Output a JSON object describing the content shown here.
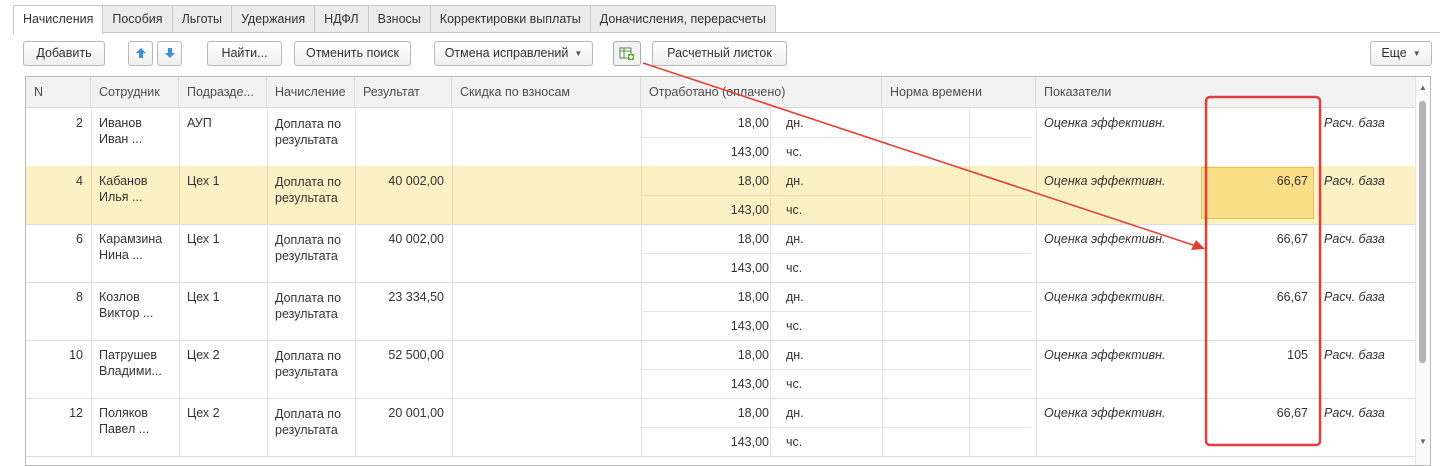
{
  "tabs": [
    "Начисления",
    "Пособия",
    "Льготы",
    "Удержания",
    "НДФЛ",
    "Взносы",
    "Корректировки выплаты",
    "Доначисления, перерасчеты"
  ],
  "toolbar": {
    "add": "Добавить",
    "find": "Найти...",
    "cancel_search": "Отменить поиск",
    "cancel_fix": "Отмена исправлений",
    "payslip": "Расчетный листок",
    "more": "Еще",
    "up_icon": "arrow-up-icon",
    "down_icon": "arrow-down-icon",
    "table_icon": "table-add-icon"
  },
  "columns": {
    "n": "N",
    "employee": "Сотрудник",
    "dept": "Подразде...",
    "accrual": "Начисление",
    "result": "Результат",
    "discount": "Скидка по взносам",
    "worked": "Отработано (оплачено)",
    "norm": "Норма времени",
    "indicators": "Показатели"
  },
  "rows": [
    {
      "n": "2",
      "name1": "Иванов",
      "name2": "Иван ...",
      "dept": "АУП",
      "accrual": "Доплата по результата",
      "result": "",
      "days": "18,00",
      "days_u": "дн.",
      "hours": "143,00",
      "hours_u": "чс.",
      "indicator": "Оценка эффективн.",
      "value": "",
      "base": "Расч. база"
    },
    {
      "n": "4",
      "name1": "Кабанов",
      "name2": "Илья ...",
      "dept": "Цех 1",
      "accrual": "Доплата по результата",
      "result": "40 002,00",
      "days": "18,00",
      "days_u": "дн.",
      "hours": "143,00",
      "hours_u": "чс.",
      "indicator": "Оценка эффективн.",
      "value": "66,67",
      "base": "Расч. база"
    },
    {
      "n": "6",
      "name1": "Карамзина",
      "name2": "Нина ...",
      "dept": "Цех 1",
      "accrual": "Доплата по результата",
      "result": "40 002,00",
      "days": "18,00",
      "days_u": "дн.",
      "hours": "143,00",
      "hours_u": "чс.",
      "indicator": "Оценка эффективн.",
      "value": "66,67",
      "base": "Расч. база"
    },
    {
      "n": "8",
      "name1": "Козлов",
      "name2": "Виктор ...",
      "dept": "Цех 1",
      "accrual": "Доплата по результата",
      "result": "23 334,50",
      "days": "18,00",
      "days_u": "дн.",
      "hours": "143,00",
      "hours_u": "чс.",
      "indicator": "Оценка эффективн.",
      "value": "66,67",
      "base": "Расч. база"
    },
    {
      "n": "10",
      "name1": "Патрушев",
      "name2": "Владими...",
      "dept": "Цех 2",
      "accrual": "Доплата по результата",
      "result": "52 500,00",
      "days": "18,00",
      "days_u": "дн.",
      "hours": "143,00",
      "hours_u": "чс.",
      "indicator": "Оценка эффективн.",
      "value": "105",
      "base": "Расч. база"
    },
    {
      "n": "12",
      "name1": "Поляков",
      "name2": "Павел ...",
      "dept": "Цех 2",
      "accrual": "Доплата по результата",
      "result": "20 001,00",
      "days": "18,00",
      "days_u": "дн.",
      "hours": "143,00",
      "hours_u": "чс.",
      "indicator": "Оценка эффективн.",
      "value": "66,67",
      "base": "Расч. база"
    }
  ],
  "selected_row": 1,
  "colors": {
    "selection": "#fbf1c5",
    "annotation": "#e0403a"
  }
}
